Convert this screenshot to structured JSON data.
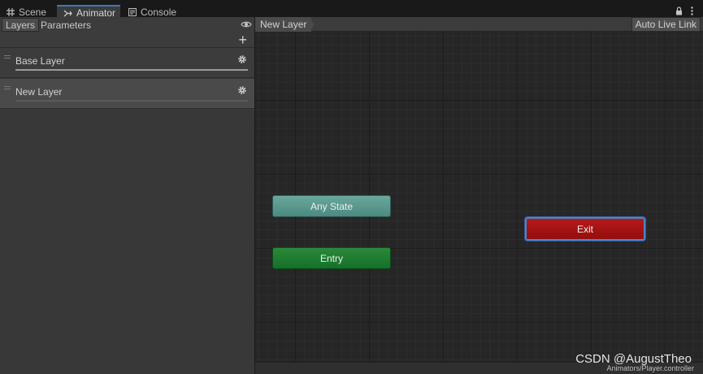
{
  "tabs": [
    {
      "label": "Scene",
      "icon": "grid-icon",
      "active": false
    },
    {
      "label": "Animator",
      "icon": "animator-icon",
      "active": true
    },
    {
      "label": "Console",
      "icon": "console-icon",
      "active": false
    }
  ],
  "left_panel": {
    "tabs": [
      "Layers",
      "Parameters"
    ],
    "selected_tab": "Layers",
    "add_label": "+",
    "layers": [
      {
        "name": "Base Layer",
        "selected": false
      },
      {
        "name": "New Layer",
        "selected": true
      }
    ]
  },
  "graph": {
    "breadcrumb": "New Layer",
    "auto_live_link": "Auto Live Link",
    "nodes": {
      "any_state": "Any State",
      "entry": "Entry",
      "exit": "Exit"
    },
    "controller_path": "Animators/Player.controller"
  },
  "watermark": "CSDN @AugustTheo",
  "colors": {
    "any_state": "#5b998f",
    "entry": "#1e7d31",
    "exit": "#a51313",
    "selection": "#4d86c9",
    "tab_accent": "#3a79bb"
  }
}
